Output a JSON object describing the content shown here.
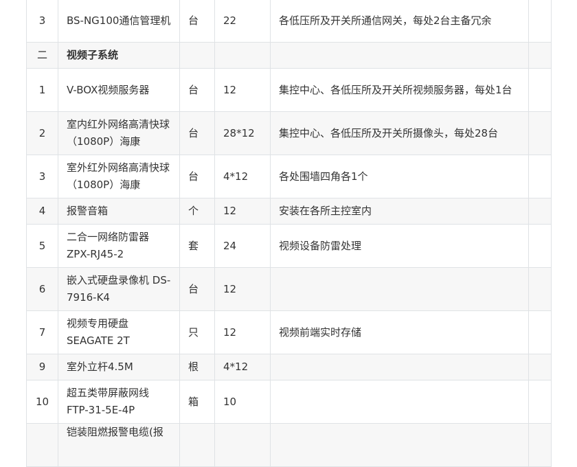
{
  "rows": [
    {
      "no": "3",
      "name": "BS-NG100通信管理机",
      "unit": "台",
      "qty": "22",
      "note": "各低压所及开关所通信网关，每处2台主备冗余"
    },
    {
      "no": "二",
      "name": "视频子系统",
      "unit": "",
      "qty": "",
      "note": "",
      "section": true
    },
    {
      "no": "1",
      "name": "V-BOX视频服务器",
      "unit": "台",
      "qty": "12",
      "note": "集控中心、各低压所及开关所视频服务器，每处1台"
    },
    {
      "no": "2",
      "name": "室内红外网络高清快球（1080P）海康",
      "unit": "台",
      "qty": "28*12",
      "note": "集控中心、各低压所及开关所摄像头，每处28台"
    },
    {
      "no": "3",
      "name": "室外红外网络高清快球（1080P）海康",
      "unit": "台",
      "qty": "4*12",
      "note": "各处围墙四角各1个"
    },
    {
      "no": "4",
      "name": "报警音箱",
      "unit": "个",
      "qty": "12",
      "note": "安装在各所主控室内"
    },
    {
      "no": "5",
      "name": "二合一网络防雷器 ZPX-RJ45-2",
      "unit": "套",
      "qty": "24",
      "note": "视频设备防雷处理"
    },
    {
      "no": "6",
      "name": "嵌入式硬盘录像机 DS-7916-K4",
      "unit": "台",
      "qty": "12",
      "note": ""
    },
    {
      "no": "7",
      "name": "视频专用硬盘 SEAGATE 2T",
      "unit": "只",
      "qty": "12",
      "note": "视频前端实时存储"
    },
    {
      "no": "9",
      "name": "室外立杆4.5M",
      "unit": "根",
      "qty": "4*12",
      "note": ""
    },
    {
      "no": "10",
      "name": "超五类带屏蔽网线 FTP-31-5E-4P",
      "unit": "箱",
      "qty": "10",
      "note": ""
    },
    {
      "no": "",
      "name": "铠装阻燃报警电缆(报",
      "unit": "",
      "qty": "",
      "note": ""
    }
  ]
}
